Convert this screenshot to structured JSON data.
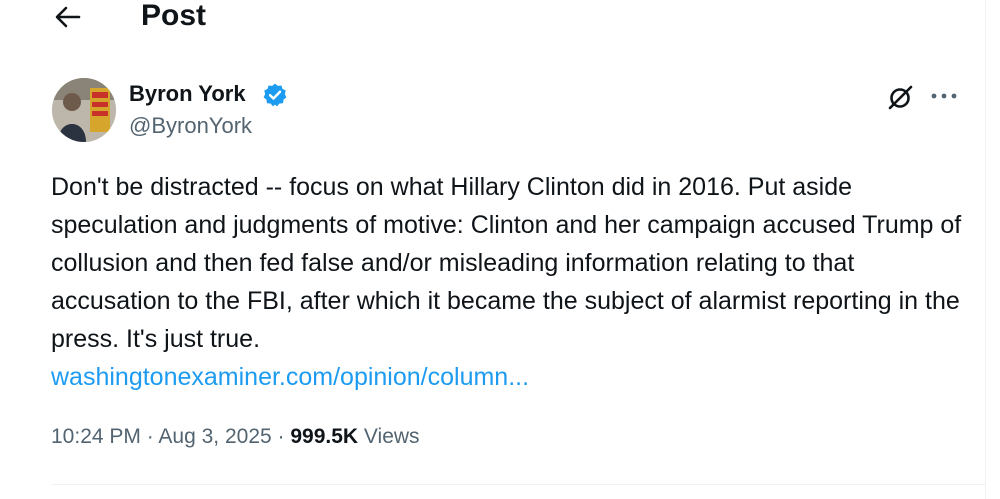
{
  "header": {
    "title": "Post",
    "back_icon": "arrow-left-icon"
  },
  "author": {
    "name": "Byron York",
    "handle": "@ByronYork",
    "verified": true,
    "badge_color": "#1d9bf0"
  },
  "actions": {
    "grok_icon": "grok-icon",
    "more_icon": "more-horizontal-icon"
  },
  "tweet": {
    "text": "Don't be distracted -- focus on what Hillary Clinton did in 2016. Put aside speculation and judgments of motive: Clinton and her campaign accused Trump of collusion and then fed false and/or misleading information relating to that accusation to the FBI, after which it became the subject of alarmist reporting in the press. It's just true.",
    "link_text": "washingtonexaminer.com/opinion/column..."
  },
  "meta": {
    "time": "10:24 PM",
    "separator": " · ",
    "date": "Aug 3, 2025",
    "views_count": "999.5K",
    "views_label": "Views"
  },
  "colors": {
    "text_primary": "#0f1419",
    "text_secondary": "#536471",
    "link": "#1d9bf0"
  }
}
